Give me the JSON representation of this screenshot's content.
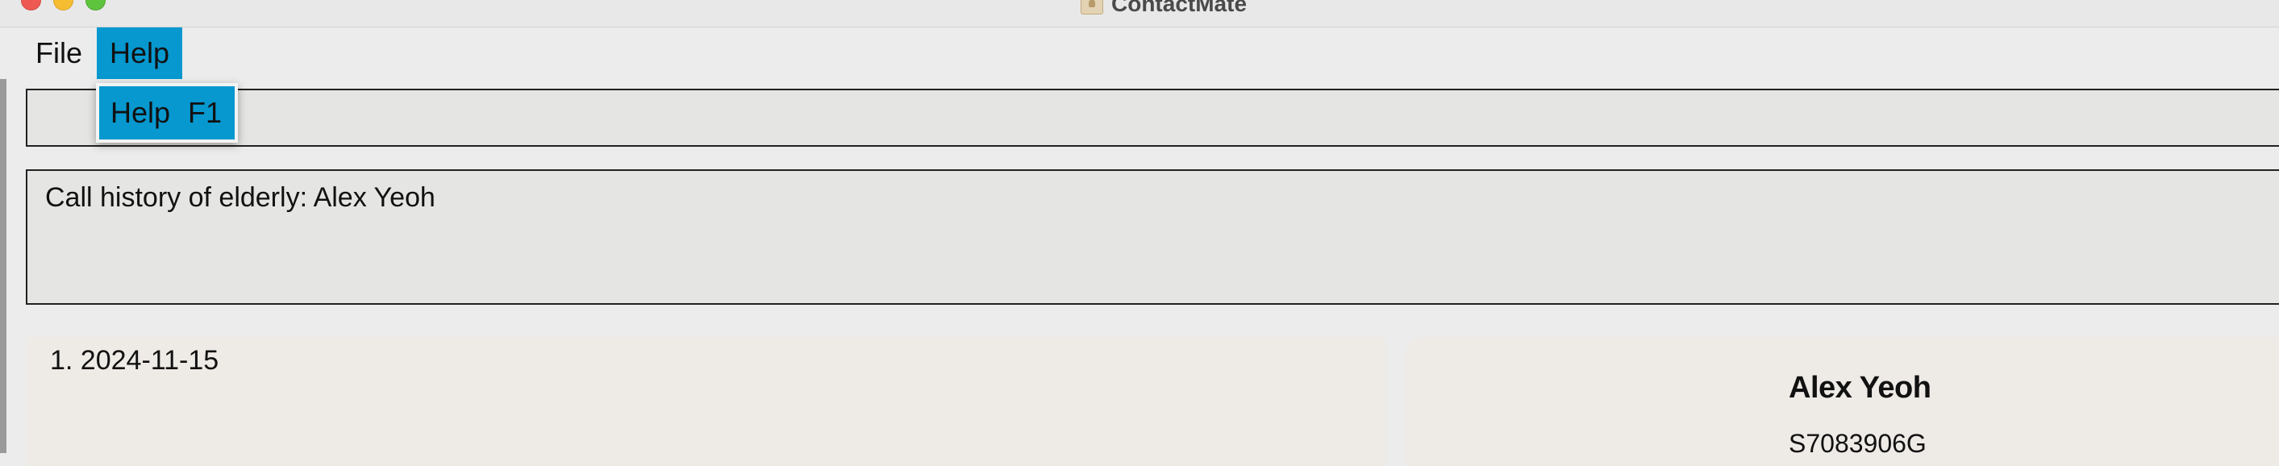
{
  "window": {
    "title": "ContactMate",
    "icon": "contact-book-icon"
  },
  "menubar": {
    "items": [
      {
        "label": "File"
      },
      {
        "label": "Help"
      }
    ]
  },
  "help_menu": {
    "items": [
      {
        "label": "Help",
        "accelerator": "F1"
      }
    ]
  },
  "command_box": {
    "value": ""
  },
  "result_display": {
    "text": "Call history of elderly: Alex Yeoh"
  },
  "call_history": {
    "items": [
      {
        "text": "1. 2024-11-15"
      }
    ]
  },
  "person_detail": {
    "name": "Alex Yeoh",
    "nric": "S7083906G"
  },
  "colors": {
    "menu_highlight": "#0698cf",
    "panel_background": "#eeeae6",
    "box_background": "#e5e5e3"
  }
}
